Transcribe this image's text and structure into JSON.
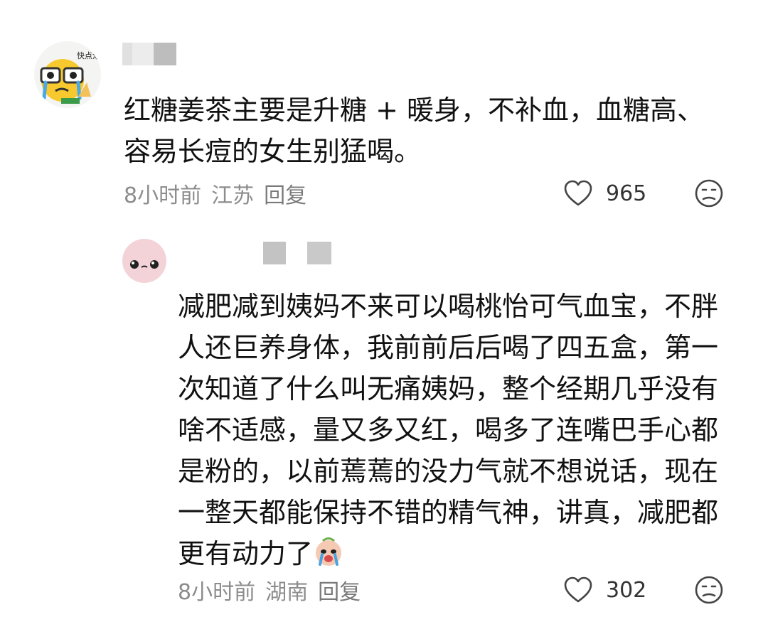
{
  "comments": [
    {
      "avatar_label": "快点涂",
      "text": "红糖姜茶主要是升糖 + 暖身，不补血，血糖高、容易长痘的女生别猛喝。",
      "time": "8小时前",
      "location": "江苏",
      "reply_label": "回复",
      "like_count": "965",
      "like_icon": "heart-outline-icon",
      "dislike_icon": "unhappy-face-icon"
    },
    {
      "text": "减肥减到姨妈不来可以喝桃怡可气血宝，不胖人还巨养身体，我前前后后喝了四五盒，第一次知道了什么叫无痛姨妈，整个经期几乎没有啥不适感，量又多又红，喝多了连嘴巴手心都是粉的，以前蔫蔫的没力气就不想说话，现在一整天都能保持不错的精气神，讲真，减肥都更有动力了",
      "trailing_emoji": "crying-face-emoji",
      "time": "8小时前",
      "location": "湖南",
      "reply_label": "回复",
      "like_count": "302",
      "like_icon": "heart-outline-icon",
      "dislike_icon": "unhappy-face-icon"
    }
  ],
  "colors": {
    "text": "#111111",
    "meta": "#8c8c8c",
    "blur": "#c9c9c9"
  }
}
